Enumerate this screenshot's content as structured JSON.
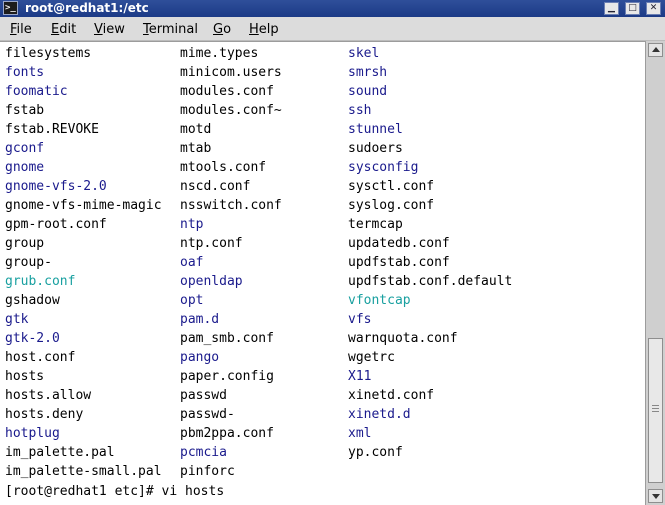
{
  "window": {
    "title": "root@redhat1:/etc",
    "app_icon": "terminal-icon",
    "buttons": [
      {
        "name": "minimize-button",
        "icon": "minimize-icon",
        "glyph": "▁"
      },
      {
        "name": "maximize-button",
        "icon": "maximize-icon",
        "glyph": "□"
      },
      {
        "name": "close-button",
        "icon": "close-icon",
        "glyph": "✕"
      }
    ]
  },
  "menu": [
    {
      "label": "File",
      "mnemonic": "F"
    },
    {
      "label": "Edit",
      "mnemonic": "E"
    },
    {
      "label": "View",
      "mnemonic": "V"
    },
    {
      "label": "Terminal",
      "mnemonic": "T"
    },
    {
      "label": "Go",
      "mnemonic": "G"
    },
    {
      "label": "Help",
      "mnemonic": "H"
    }
  ],
  "colors": {
    "directory": "#1a1a8c",
    "executable": "#19a0a0",
    "file": "#000000",
    "titlebar": "#2f4f9a"
  },
  "listing": {
    "columns": [
      [
        {
          "name": "filesystems",
          "type": "file"
        },
        {
          "name": "fonts",
          "type": "directory"
        },
        {
          "name": "foomatic",
          "type": "directory"
        },
        {
          "name": "fstab",
          "type": "file"
        },
        {
          "name": "fstab.REVOKE",
          "type": "file"
        },
        {
          "name": "gconf",
          "type": "directory"
        },
        {
          "name": "gnome",
          "type": "directory"
        },
        {
          "name": "gnome-vfs-2.0",
          "type": "directory"
        },
        {
          "name": "gnome-vfs-mime-magic",
          "type": "file"
        },
        {
          "name": "gpm-root.conf",
          "type": "file"
        },
        {
          "name": "group",
          "type": "file"
        },
        {
          "name": "group-",
          "type": "file"
        },
        {
          "name": "grub.conf",
          "type": "executable"
        },
        {
          "name": "gshadow",
          "type": "file"
        },
        {
          "name": "gtk",
          "type": "directory"
        },
        {
          "name": "gtk-2.0",
          "type": "directory"
        },
        {
          "name": "host.conf",
          "type": "file"
        },
        {
          "name": "hosts",
          "type": "file"
        },
        {
          "name": "hosts.allow",
          "type": "file"
        },
        {
          "name": "hosts.deny",
          "type": "file"
        },
        {
          "name": "hotplug",
          "type": "directory"
        },
        {
          "name": "im_palette.pal",
          "type": "file"
        },
        {
          "name": "im_palette-small.pal",
          "type": "file"
        }
      ],
      [
        {
          "name": "mime.types",
          "type": "file"
        },
        {
          "name": "minicom.users",
          "type": "file"
        },
        {
          "name": "modules.conf",
          "type": "file"
        },
        {
          "name": "modules.conf~",
          "type": "file"
        },
        {
          "name": "motd",
          "type": "file"
        },
        {
          "name": "mtab",
          "type": "file"
        },
        {
          "name": "mtools.conf",
          "type": "file"
        },
        {
          "name": "nscd.conf",
          "type": "file"
        },
        {
          "name": "nsswitch.conf",
          "type": "file"
        },
        {
          "name": "ntp",
          "type": "directory"
        },
        {
          "name": "ntp.conf",
          "type": "file"
        },
        {
          "name": "oaf",
          "type": "directory"
        },
        {
          "name": "openldap",
          "type": "directory"
        },
        {
          "name": "opt",
          "type": "directory"
        },
        {
          "name": "pam.d",
          "type": "directory"
        },
        {
          "name": "pam_smb.conf",
          "type": "file"
        },
        {
          "name": "pango",
          "type": "directory"
        },
        {
          "name": "paper.config",
          "type": "file"
        },
        {
          "name": "passwd",
          "type": "file"
        },
        {
          "name": "passwd-",
          "type": "file"
        },
        {
          "name": "pbm2ppa.conf",
          "type": "file"
        },
        {
          "name": "pcmcia",
          "type": "directory"
        },
        {
          "name": "pinforc",
          "type": "file"
        }
      ],
      [
        {
          "name": "skel",
          "type": "directory"
        },
        {
          "name": "smrsh",
          "type": "directory"
        },
        {
          "name": "sound",
          "type": "directory"
        },
        {
          "name": "ssh",
          "type": "directory"
        },
        {
          "name": "stunnel",
          "type": "directory"
        },
        {
          "name": "sudoers",
          "type": "file"
        },
        {
          "name": "sysconfig",
          "type": "directory"
        },
        {
          "name": "sysctl.conf",
          "type": "file"
        },
        {
          "name": "syslog.conf",
          "type": "file"
        },
        {
          "name": "termcap",
          "type": "file"
        },
        {
          "name": "updatedb.conf",
          "type": "file"
        },
        {
          "name": "updfstab.conf",
          "type": "file"
        },
        {
          "name": "updfstab.conf.default",
          "type": "file"
        },
        {
          "name": "vfontcap",
          "type": "executable"
        },
        {
          "name": "vfs",
          "type": "directory"
        },
        {
          "name": "warnquota.conf",
          "type": "file"
        },
        {
          "name": "wgetrc",
          "type": "file"
        },
        {
          "name": "X11",
          "type": "directory"
        },
        {
          "name": "xinetd.conf",
          "type": "file"
        },
        {
          "name": "xinetd.d",
          "type": "directory"
        },
        {
          "name": "xml",
          "type": "directory"
        },
        {
          "name": "yp.conf",
          "type": "file"
        }
      ]
    ]
  },
  "prompt": {
    "text": "[root@redhat1 etc]# vi hosts"
  },
  "scrollbar": {
    "position": 0.95
  }
}
